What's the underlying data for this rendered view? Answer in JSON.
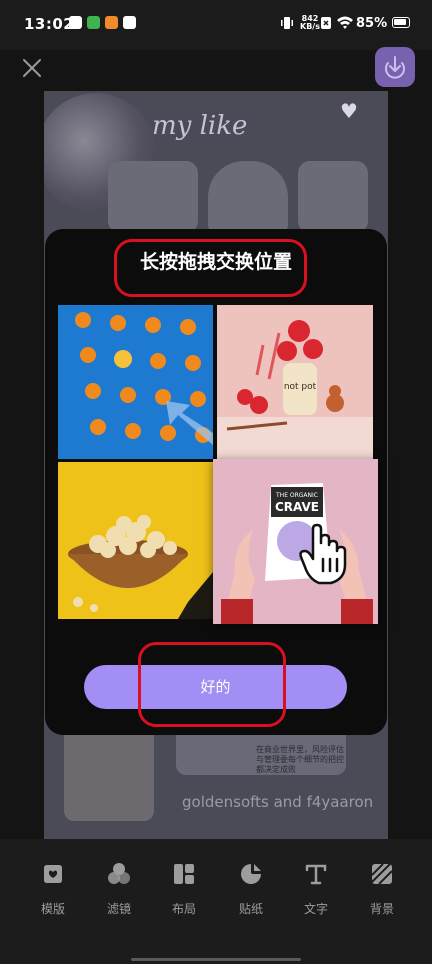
{
  "status_bar": {
    "time": "13:02",
    "net_speed": "842",
    "net_unit": "KB/s",
    "battery": "85%"
  },
  "canvas": {
    "title_text": "my like",
    "credit": "goldensofts and f4yaaron",
    "note": "在商业世界里，风险评估与管理委每个细节的把控都决定成败"
  },
  "modal": {
    "title": "长按拖拽交换位置",
    "confirm_label": "好的",
    "photo_label": "CRAVE",
    "photo_brand": "THE ORGANIC",
    "jar_label": "not pot"
  },
  "toolbar": {
    "items": [
      {
        "label": "模版",
        "icon": "template-icon"
      },
      {
        "label": "滤镜",
        "icon": "filter-icon"
      },
      {
        "label": "布局",
        "icon": "layout-icon"
      },
      {
        "label": "贴纸",
        "icon": "sticker-icon"
      },
      {
        "label": "文字",
        "icon": "text-icon"
      },
      {
        "label": "背景",
        "icon": "background-icon"
      }
    ]
  },
  "colors": {
    "accent": "#a38ef5",
    "download_bg": "#7862b0",
    "annotation": "#d8101f"
  }
}
